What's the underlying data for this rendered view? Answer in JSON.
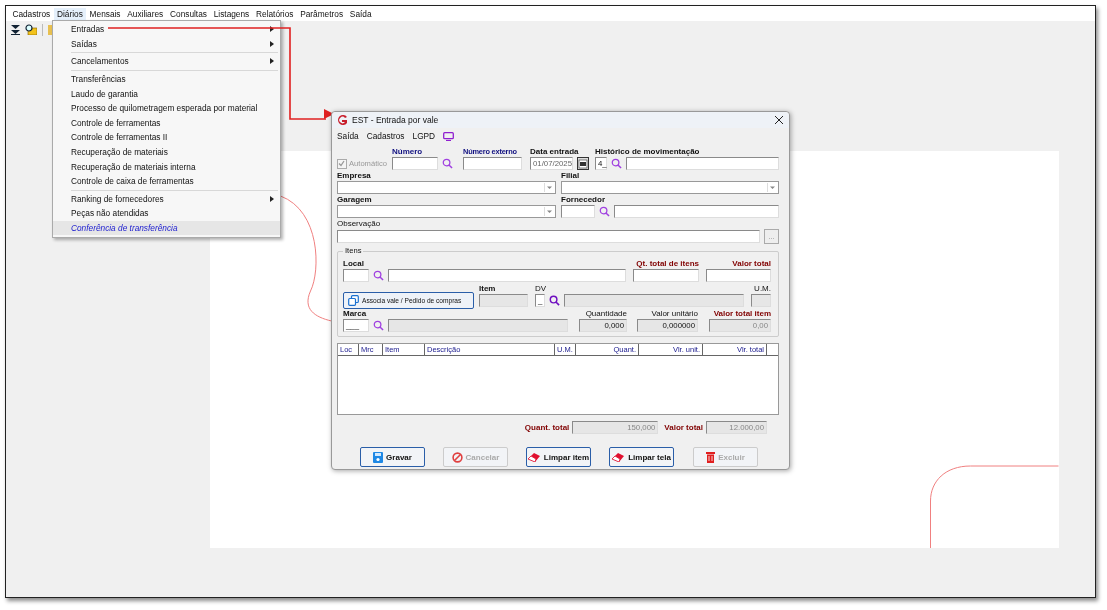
{
  "menubar": [
    {
      "label": "Cadastros",
      "selected": false
    },
    {
      "label": "Diários",
      "selected": true
    },
    {
      "label": "Mensais",
      "selected": false
    },
    {
      "label": "Auxiliares",
      "selected": false
    },
    {
      "label": "Consultas",
      "selected": false
    },
    {
      "label": "Listagens",
      "selected": false
    },
    {
      "label": "Relatórios",
      "selected": false
    },
    {
      "label": "Parâmetros",
      "selected": false
    },
    {
      "label": "Saída",
      "selected": false
    }
  ],
  "dropdown": [
    [
      {
        "label": "Entradas",
        "submenu": true,
        "selected": false
      },
      {
        "label": "Saídas",
        "submenu": true,
        "selected": false
      }
    ],
    [
      {
        "label": "Cancelamentos",
        "submenu": true,
        "selected": false
      }
    ],
    [
      {
        "label": "Transferências",
        "submenu": false,
        "selected": false
      },
      {
        "label": "Laudo de garantia",
        "submenu": false,
        "selected": false
      },
      {
        "label": "Processo de quilometragem esperada por material",
        "submenu": false,
        "selected": false
      },
      {
        "label": "Controle de ferramentas",
        "submenu": false,
        "selected": false
      },
      {
        "label": "Controle de ferramentas II",
        "submenu": false,
        "selected": false
      },
      {
        "label": "Recuperação de materiais",
        "submenu": false,
        "selected": false
      },
      {
        "label": "Recuperação de materiais interna",
        "submenu": false,
        "selected": false
      },
      {
        "label": "Controle de caixa de ferramentas",
        "submenu": false,
        "selected": false
      }
    ],
    [
      {
        "label": "Ranking de fornecedores",
        "submenu": true,
        "selected": false
      },
      {
        "label": "Peças não atendidas",
        "submenu": false,
        "selected": false
      },
      {
        "label": "Conferência de transferência",
        "submenu": false,
        "selected": true
      }
    ]
  ],
  "dialog": {
    "title": "EST - Entrada por vale",
    "menu": [
      "Saída",
      "Cadastros",
      "LGPD"
    ],
    "automatico": {
      "label": "Automático",
      "checked": true,
      "disabled": true
    },
    "numero": {
      "label": "Número"
    },
    "numero_externo": {
      "label": "Número externo"
    },
    "data_entrada": {
      "label": "Data entrada",
      "value": "01/07/2025"
    },
    "historico": {
      "label": "Histórico de movimentação",
      "code": "4_"
    },
    "empresa": {
      "label": "Empresa"
    },
    "filial": {
      "label": "Filial"
    },
    "garagem": {
      "label": "Garagem"
    },
    "fornecedor": {
      "label": "Fornecedor"
    },
    "observacao": {
      "label": "Observação",
      "button": "..."
    },
    "itens": {
      "title": "Itens",
      "local": "Local",
      "qt_total": "Qt. total de itens",
      "valor_total": "Valor total",
      "associa_button": "Associa vale / Pedido de compras",
      "item": "Item",
      "dv": {
        "label": "DV",
        "value": "_"
      },
      "um": "U.M.",
      "marca": {
        "label": "Marca",
        "value": "___"
      },
      "quantidade": {
        "label": "Quantidade",
        "value": "0,000"
      },
      "valor_unitario": {
        "label": "Valor unitário",
        "value": "0,000000"
      },
      "valor_total_item": {
        "label": "Valor total item",
        "value": "0,00"
      }
    },
    "table": {
      "columns": [
        "Loc",
        "Mrc",
        "Item",
        "Descrição",
        "U.M.",
        "Quant.",
        "Vlr. unit.",
        "Vlr. total"
      ]
    },
    "totals": {
      "quant_label": "Quant. total",
      "quant_value": "150,000",
      "valor_label": "Valor total",
      "valor_value": "12.000,00"
    },
    "buttons": [
      {
        "label": "Gravar",
        "kind": "save",
        "disabled": false
      },
      {
        "label": "Cancelar",
        "kind": "cancel",
        "disabled": true
      },
      {
        "label": "Limpar item",
        "kind": "eraser",
        "disabled": false
      },
      {
        "label": "Limpar tela",
        "kind": "eraser",
        "disabled": false
      },
      {
        "label": "Excluir",
        "kind": "delete",
        "disabled": true
      }
    ]
  }
}
